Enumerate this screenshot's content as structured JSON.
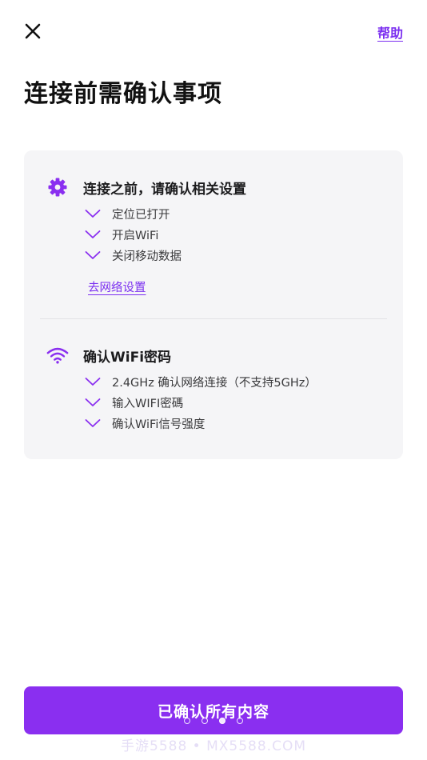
{
  "header": {
    "close_icon": "close-icon",
    "help_label": "帮助"
  },
  "page": {
    "title": "连接前需确认事项"
  },
  "card": {
    "sections": [
      {
        "icon": "gear-icon",
        "title": "连接之前，请确认相关设置",
        "items": [
          "定位已打开",
          "开启WiFi",
          "关闭移动数据"
        ],
        "link_label": "去网络设置"
      },
      {
        "icon": "wifi-icon",
        "title": "确认WiFi密码",
        "items": [
          "2.4GHz 确认网络连接（不支持5GHz）",
          "输入WIFI密碼",
          "确认WiFi信号强度"
        ]
      }
    ]
  },
  "footer": {
    "confirm_label": "已确认所有内容",
    "pager": {
      "total": 4,
      "active_index": 2
    },
    "watermark": "手游5588 • MX5588.COM"
  },
  "colors": {
    "accent": "#8a2ff0",
    "link": "#7b2ff0",
    "card_bg": "#f5f5f7"
  }
}
